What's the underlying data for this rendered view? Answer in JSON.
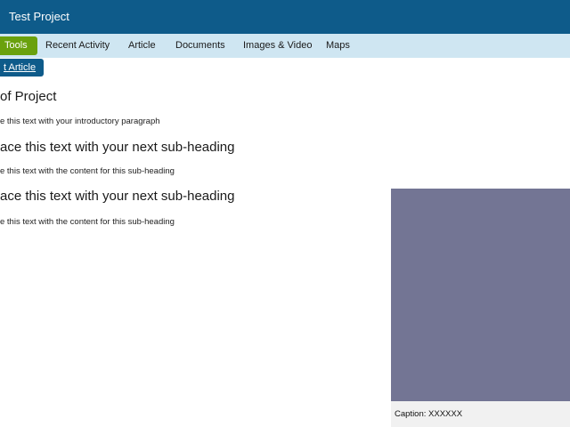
{
  "header": {
    "title": "Test Project"
  },
  "nav": {
    "items": [
      {
        "label": "Tools",
        "active": true
      },
      {
        "label": "Recent Activity"
      },
      {
        "label": "Article"
      },
      {
        "label": "Documents"
      },
      {
        "label": "Images & Video"
      },
      {
        "label": "Maps"
      }
    ]
  },
  "toolbar": {
    "article_button_label": "t Article"
  },
  "main": {
    "title": "of Project",
    "intro": "e this text with your introductory paragraph",
    "sections": [
      {
        "heading": "ace this text with your next sub-heading",
        "body": "e this text with the content for this sub-heading"
      },
      {
        "heading": "ace this text with your next sub-heading",
        "body": "e this text with the content for this sub-heading"
      }
    ]
  },
  "media": {
    "caption": "Caption: XXXXXX",
    "placeholder_color": "#737594"
  },
  "colors": {
    "header_bg": "#0e5b8a",
    "nav_bg": "#cfe6f2",
    "active_tab": "#6aa10d"
  }
}
